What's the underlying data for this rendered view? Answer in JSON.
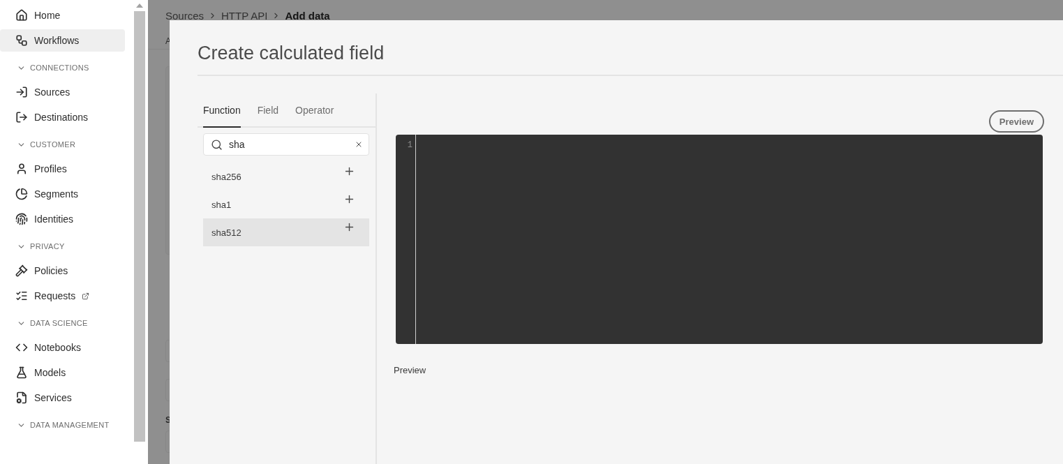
{
  "sidebar": {
    "items": [
      {
        "label": "Home",
        "selected": false
      },
      {
        "label": "Workflows",
        "selected": true
      }
    ],
    "sections": [
      {
        "label": "CONNECTIONS",
        "expanded": true,
        "items": [
          {
            "label": "Sources",
            "selected": false
          },
          {
            "label": "Destinations",
            "selected": false
          }
        ]
      },
      {
        "label": "CUSTOMER",
        "expanded": true,
        "items": [
          {
            "label": "Profiles",
            "selected": false
          },
          {
            "label": "Segments",
            "selected": false
          },
          {
            "label": "Identities",
            "selected": false
          }
        ]
      },
      {
        "label": "PRIVACY",
        "expanded": true,
        "items": [
          {
            "label": "Policies",
            "selected": false
          },
          {
            "label": "Requests",
            "selected": false,
            "external": true
          }
        ]
      },
      {
        "label": "DATA SCIENCE",
        "expanded": true,
        "items": [
          {
            "label": "Notebooks",
            "selected": false
          },
          {
            "label": "Models",
            "selected": false
          },
          {
            "label": "Services",
            "selected": false
          }
        ]
      },
      {
        "label": "DATA MANAGEMENT",
        "expanded": true
      }
    ]
  },
  "page": {
    "breadcrumb": [
      {
        "label": "Sources",
        "current": false
      },
      {
        "label": "HTTP API",
        "current": false
      },
      {
        "label": "Add data",
        "current": true
      }
    ],
    "fragments": [
      {
        "kind": "subtitle",
        "text": "A"
      },
      {
        "kind": "label",
        "text": "S"
      }
    ]
  },
  "modal": {
    "title": "Create calculated field",
    "tabs": [
      {
        "label": "Function",
        "selected": true
      },
      {
        "label": "Field",
        "selected": false
      },
      {
        "label": "Operator",
        "selected": false
      }
    ],
    "search": {
      "value": "sha"
    },
    "results": [
      {
        "label": "sha256",
        "selected": false
      },
      {
        "label": "sha1",
        "selected": false
      },
      {
        "label": "sha512",
        "selected": true
      }
    ],
    "preview_button": "Preview",
    "editor": {
      "line_numbers": [
        "1"
      ]
    },
    "preview_label": "Preview"
  }
}
